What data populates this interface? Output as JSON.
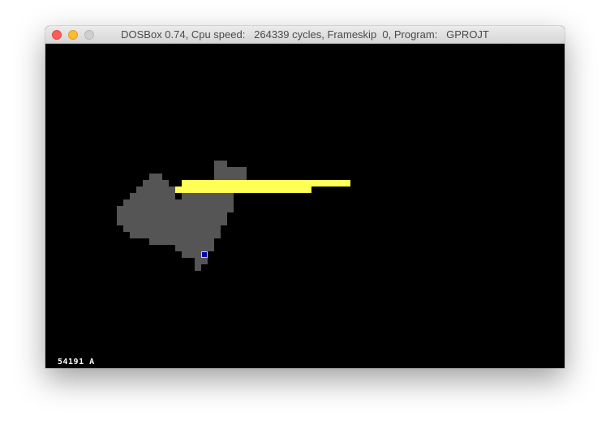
{
  "window": {
    "title": "DOSBox 0.74, Cpu speed:   264339 cycles, Frameskip  0, Program:   GPROJT"
  },
  "screen": {
    "status_text": "54191 A",
    "colors": {
      "background": "#000000",
      "land": "#555555",
      "highlight": "#ffff55",
      "cursor_fill": "#0000aa",
      "cursor_border": "#55ffff",
      "status": "#ffffff"
    }
  }
}
